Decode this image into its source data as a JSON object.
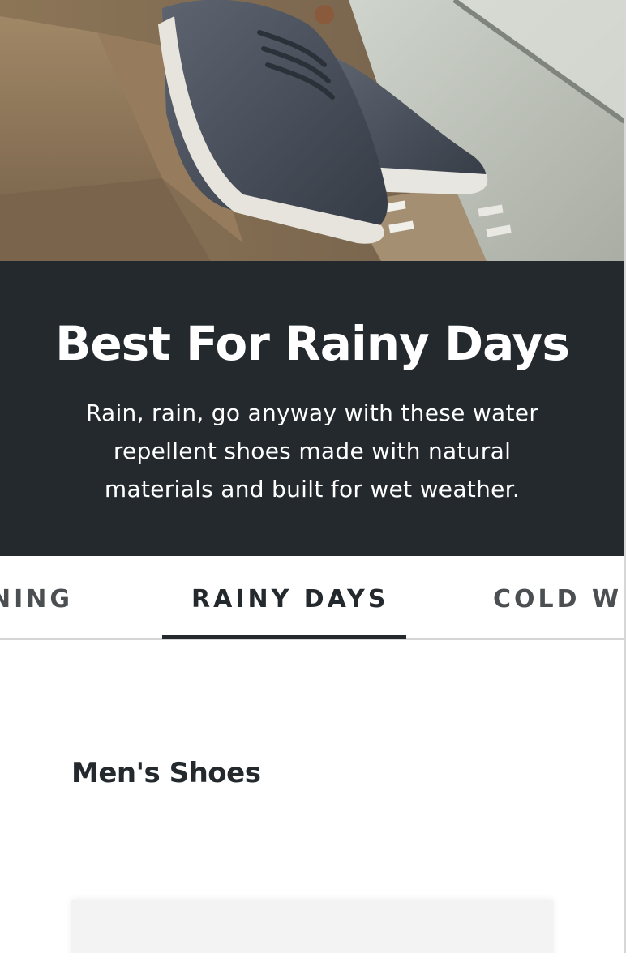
{
  "hero": {
    "image": "wool-sneakers-on-rainy-steps-photo"
  },
  "banner": {
    "title": "Best For Rainy Days",
    "description": "Rain, rain, go anyway with these water repellent shoes made with natural materials and built for wet weather.",
    "background_color": "#23292d",
    "text_color": "#ffffff"
  },
  "tabs": {
    "items": [
      {
        "label": "RUNNING",
        "visible_text": "NING",
        "active": false
      },
      {
        "label": "RAINY DAYS",
        "visible_text": "RAINY DAYS",
        "active": true
      },
      {
        "label": "COLD WEATHER",
        "visible_text": "COLD WE",
        "active": false
      }
    ],
    "active_underline_color": "#23292d"
  },
  "section": {
    "heading": "Men's Shoes"
  }
}
